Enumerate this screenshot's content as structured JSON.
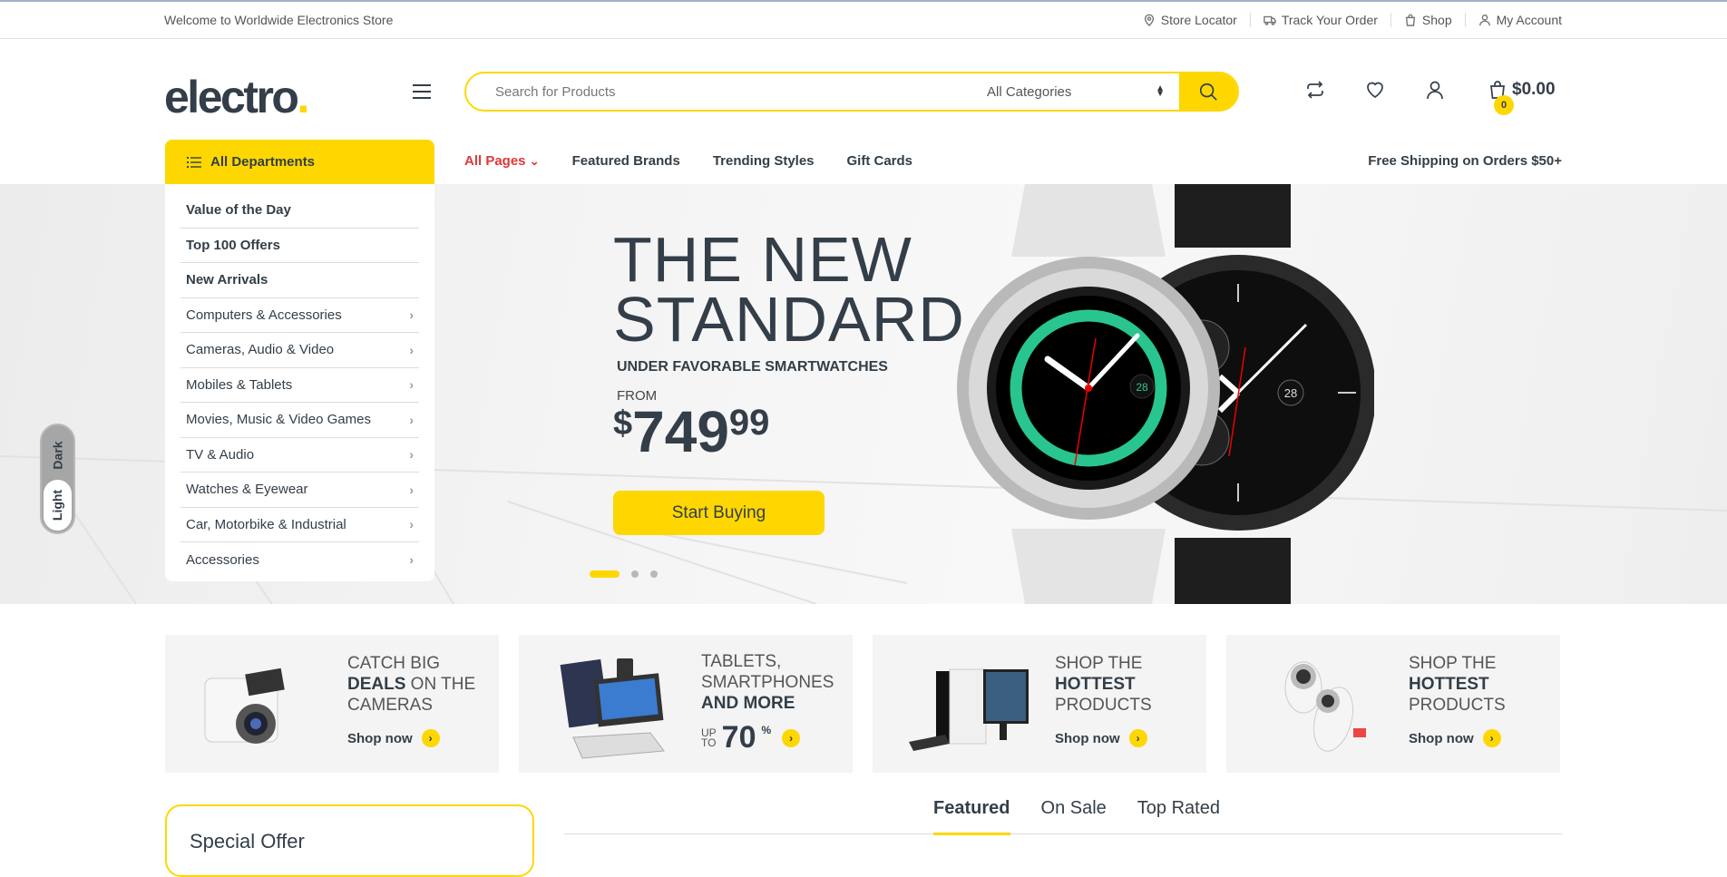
{
  "topbar": {
    "welcome": "Welcome to Worldwide Electronics Store",
    "links": [
      {
        "label": "Store Locator",
        "icon": "map-pin-icon"
      },
      {
        "label": "Track Your Order",
        "icon": "truck-icon"
      },
      {
        "label": "Shop",
        "icon": "shopping-bag-icon"
      },
      {
        "label": "My Account",
        "icon": "user-icon"
      }
    ]
  },
  "header": {
    "logo_text": "electro",
    "logo_dot": ".",
    "search": {
      "placeholder": "Search for Products",
      "value": "",
      "category_selected": "All Categories"
    },
    "cart": {
      "count": "0",
      "total": "$0.00"
    }
  },
  "nav": {
    "all_departments": "All Departments",
    "items": [
      "All Pages",
      "Featured Brands",
      "Trending Styles",
      "Gift Cards"
    ],
    "active_item_chevron": "⌄",
    "free_shipping": "Free Shipping on Orders $50+"
  },
  "departments": [
    {
      "label": "Value of the Day",
      "bold": true,
      "submenu": false
    },
    {
      "label": "Top 100 Offers",
      "bold": true,
      "submenu": false
    },
    {
      "label": "New Arrivals",
      "bold": true,
      "submenu": false
    },
    {
      "label": "Computers & Accessories",
      "bold": false,
      "submenu": true
    },
    {
      "label": "Cameras, Audio & Video",
      "bold": false,
      "submenu": true
    },
    {
      "label": "Mobiles & Tablets",
      "bold": false,
      "submenu": true
    },
    {
      "label": "Movies, Music & Video Games",
      "bold": false,
      "submenu": true
    },
    {
      "label": "TV & Audio",
      "bold": false,
      "submenu": true
    },
    {
      "label": "Watches & Eyewear",
      "bold": false,
      "submenu": true
    },
    {
      "label": "Car, Motorbike & Industrial",
      "bold": false,
      "submenu": true
    },
    {
      "label": "Accessories",
      "bold": false,
      "submenu": true
    }
  ],
  "hero": {
    "title_line1": "THE NEW",
    "title_line2": "STANDARD",
    "subtitle": "UNDER FAVORABLE SMARTWATCHES",
    "from": "FROM",
    "price_currency": "$",
    "price_main": "749",
    "price_cents": "99",
    "cta": "Start Buying",
    "slides": 3,
    "active_slide": 1,
    "watch_date_1": "28",
    "watch_date_2": "28"
  },
  "theme_toggle": {
    "dark": "Dark",
    "light": "Light",
    "selected": "Light"
  },
  "banners": [
    {
      "line1": "CATCH BIG",
      "bold": "DEALS",
      "line2_rest": " ON THE",
      "line3": "CAMERAS",
      "cta": "Shop now"
    },
    {
      "line1": "TABLETS,",
      "line2": "SMARTPHONES",
      "bold": "AND MORE",
      "up": "UP",
      "to": "TO",
      "percent_value": "70",
      "percent_sign": "%"
    },
    {
      "line1": "SHOP THE",
      "bold": "HOTTEST",
      "line3": "PRODUCTS",
      "cta": "Shop now"
    },
    {
      "line1": "SHOP THE",
      "bold": "HOTTEST",
      "line3": "PRODUCTS",
      "cta": "Shop now"
    }
  ],
  "special_offer": "Special Offer",
  "product_tabs": [
    "Featured",
    "On Sale",
    "Top Rated"
  ],
  "product_tabs_active": "Featured",
  "colors": {
    "accent": "#fed700",
    "text": "#333e48",
    "nav_active": "#df3737"
  }
}
